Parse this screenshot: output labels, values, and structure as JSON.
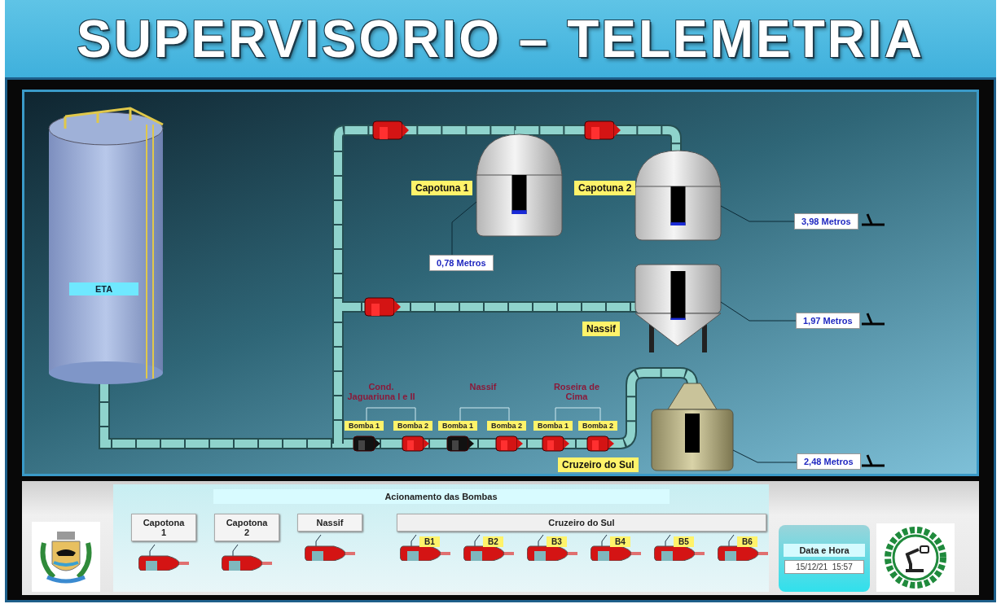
{
  "header": {
    "title": "SUPERVISORIO – TELEMETRIA"
  },
  "plant": {
    "eta": {
      "label": "ETA"
    },
    "reservoirs": [
      {
        "kind": "dome",
        "label": "Capotuna 1",
        "reading": "0,78 Metros",
        "level": 0.1
      },
      {
        "kind": "dome",
        "label": "Capotuna 2",
        "reading": "3,98 Metros",
        "level": 0.08
      },
      {
        "kind": "cone",
        "label": "Nassif",
        "reading": "1,97 Metros",
        "level": 0.04
      },
      {
        "kind": "bell",
        "label": "Cruzeiro do Sul",
        "reading": "2,48 Metros"
      }
    ],
    "line_pumps": [
      {
        "running": true
      },
      {
        "running": true
      },
      {
        "running": true
      }
    ],
    "booster_groups": [
      {
        "title": "Cond.\nJaguariuna I e II",
        "pumps": [
          {
            "label": "Bomba 1",
            "running": false
          },
          {
            "label": "Bomba 2",
            "running": true
          }
        ]
      },
      {
        "title": "Nassif",
        "pumps": [
          {
            "label": "Bomba 1",
            "running": false
          },
          {
            "label": "Bomba 2",
            "running": true
          }
        ]
      },
      {
        "title": "Roseira de\nCima",
        "pumps": [
          {
            "label": "Bomba 1",
            "running": true
          },
          {
            "label": "Bomba 2",
            "running": true
          }
        ]
      }
    ]
  },
  "control": {
    "title": "Acionamento das Bombas",
    "buttons": [
      {
        "label": "Capotona 1"
      },
      {
        "label": "Capotona 2"
      },
      {
        "label": "Nassif"
      }
    ],
    "group": {
      "label": "Cruzeiro do Sul",
      "pumps": [
        "B1",
        "B2",
        "B3",
        "B4",
        "B5",
        "B6"
      ]
    }
  },
  "clock": {
    "title": "Data e Hora",
    "value": "15/12/21  15:57"
  }
}
